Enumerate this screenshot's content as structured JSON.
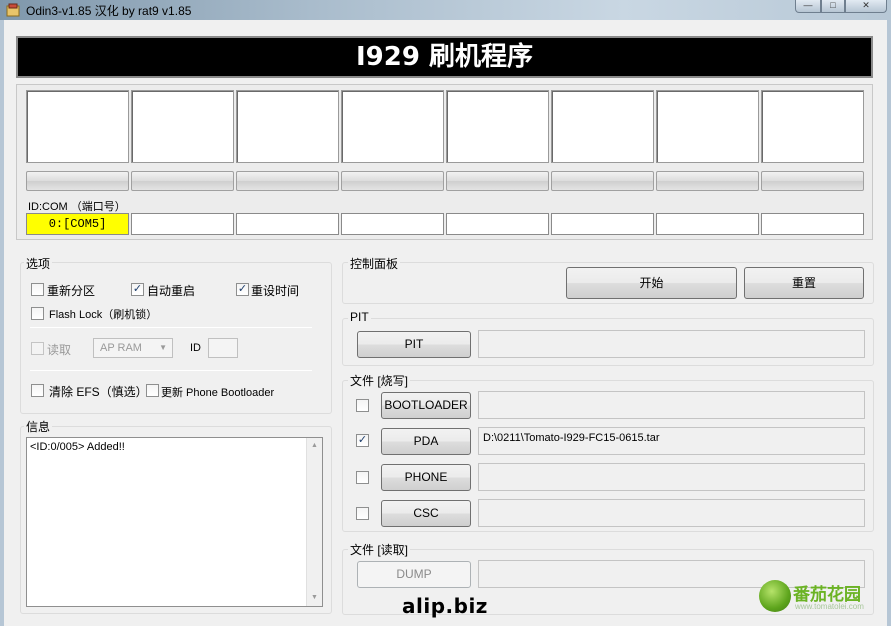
{
  "window": {
    "title": "Odin3-v1.85 汉化 by rat9 v1.85",
    "min_glyph": "—",
    "max_glyph": "□",
    "close_glyph": "✕"
  },
  "banner": {
    "title": "I929 刷机程序"
  },
  "ports": {
    "label": "ID:COM （端口号）",
    "com_values": [
      "0:[COM5]",
      "",
      "",
      "",
      "",
      "",
      "",
      ""
    ],
    "active_color": "#ffff00"
  },
  "options": {
    "title": "选项",
    "repartition_label": "重新分区",
    "repartition_checked": false,
    "auto_reboot_label": "自动重启",
    "auto_reboot_checked": true,
    "reset_time_label": "重设时间",
    "reset_time_checked": true,
    "flash_lock_label": "Flash Lock（刷机锁）",
    "flash_lock_checked": false,
    "read_label": "读取",
    "read_checked": false,
    "ap_ram_value": "AP RAM",
    "id_label": "ID",
    "clear_efs_label": "清除 EFS（慎选）",
    "clear_efs_checked": false,
    "update_bootloader_label": "更新 Phone Bootloader",
    "update_bootloader_checked": false
  },
  "info": {
    "title": "信息",
    "log": "<ID:0/005> Added!!"
  },
  "control": {
    "title": "控制面板",
    "start_label": "开始",
    "reset_label": "重置"
  },
  "pit": {
    "title": "PIT",
    "button_label": "PIT",
    "path": ""
  },
  "files_write": {
    "title": "文件 [烧写]",
    "rows": [
      {
        "label": "BOOTLOADER",
        "checked": false,
        "path": ""
      },
      {
        "label": "PDA",
        "checked": true,
        "path": "D:\\0211\\Tomato-I929-FC15-0615.tar"
      },
      {
        "label": "PHONE",
        "checked": false,
        "path": ""
      },
      {
        "label": "CSC",
        "checked": false,
        "path": ""
      }
    ]
  },
  "files_read": {
    "title": "文件 [读取]",
    "dump_label": "DUMP",
    "path": ""
  },
  "check_glyph": "✓",
  "watermark": "alip.biz",
  "site_logo": {
    "name": "番茄花园",
    "url": "www.tomatolei.com"
  }
}
